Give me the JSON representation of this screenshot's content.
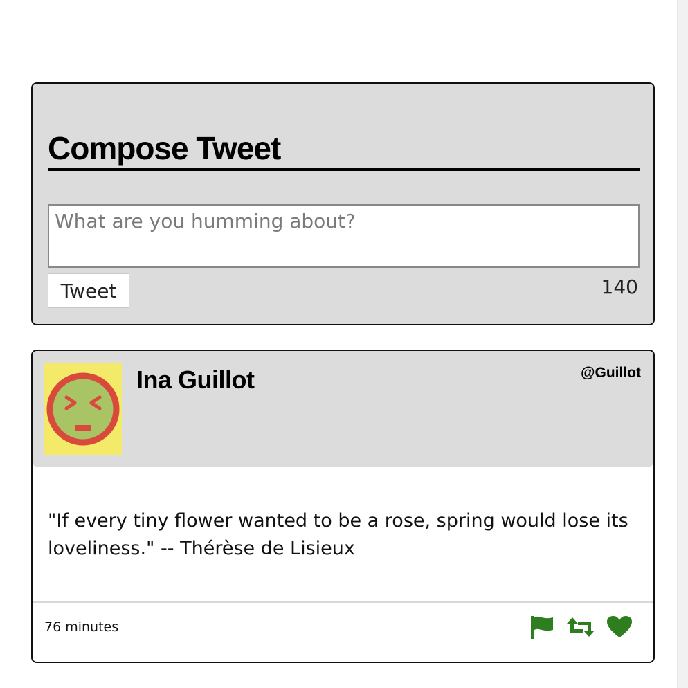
{
  "compose": {
    "title": "Compose Tweet",
    "input_placeholder": "What are you humming about?",
    "input_value": "",
    "tweet_button_label": "Tweet",
    "char_count": "140"
  },
  "tweet": {
    "name": "Ina Guillot",
    "handle": "@Guillot",
    "avatar_icon": "grimacing-face-icon",
    "content": "\"If every tiny flower wanted to be a rose, spring would lose its loveliness.\" -- Thérèse de Lisieux",
    "time": "76 minutes",
    "actions": [
      {
        "icon": "flag-icon"
      },
      {
        "icon": "retweet-icon"
      },
      {
        "icon": "heart-icon"
      }
    ]
  },
  "colors": {
    "panel_bg": "#dcdcdc",
    "border": "#111111",
    "action_green": "#2e7d1e",
    "avatar_bg": "#f3ea6a",
    "avatar_face": "#a8c464",
    "avatar_red": "#d94a3c"
  }
}
